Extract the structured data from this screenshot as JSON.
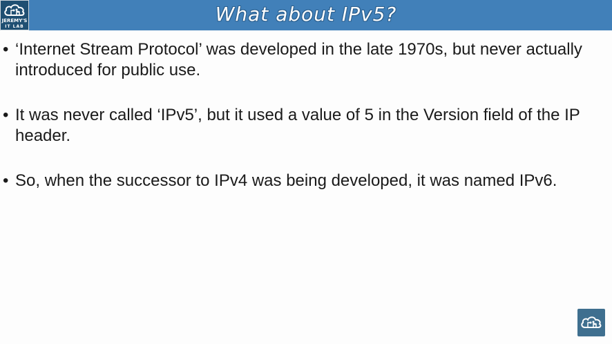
{
  "slide": {
    "title": "What about IPv5?",
    "bullet_symbol": "•",
    "bullets": [
      "‘Internet Stream Protocol’ was developed in the late 1970s, but never actually introduced for public use.",
      "It was never called ‘IPv5’, but it used a value of 5 in the Version field of the IP header.",
      "So, when the successor to IPv4 was being developed, it was named IPv6."
    ]
  },
  "logo": {
    "line1": "JEREMY'S",
    "line2": "IT LAB",
    "icon": "cloud-circuit-icon"
  },
  "colors": {
    "header_bg": "#4180b9",
    "header_text": "#ffffff",
    "body_bg": "#fdfdfd",
    "body_text": "#1a1a1a",
    "logo_bg": "#1f4f72",
    "corner_logo_bg": "#3f6f8f"
  }
}
